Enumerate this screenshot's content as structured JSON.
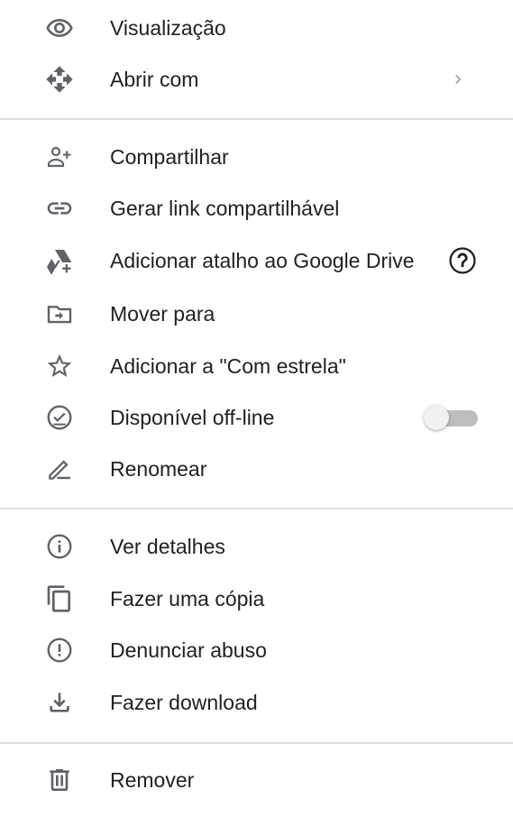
{
  "menu": {
    "items": [
      {
        "label": "Visualização",
        "icon": "eye-icon"
      },
      {
        "label": "Abrir com",
        "icon": "open-with-arrows-icon",
        "submenu": true
      },
      {
        "label": "Compartilhar",
        "icon": "person-add-icon"
      },
      {
        "label": "Gerar link compartilhável",
        "icon": "link-icon"
      },
      {
        "label": "Adicionar atalho ao Google Drive",
        "icon": "drive-shortcut-icon",
        "help": true
      },
      {
        "label": "Mover para",
        "icon": "move-to-folder-icon"
      },
      {
        "label": "Adicionar a \"Com estrela\"",
        "icon": "star-outline-icon"
      },
      {
        "label": "Disponível off-line",
        "icon": "offline-check-icon",
        "toggle": false
      },
      {
        "label": "Renomear",
        "icon": "pencil-icon"
      },
      {
        "label": "Ver detalhes",
        "icon": "info-icon"
      },
      {
        "label": "Fazer uma cópia",
        "icon": "copy-icon"
      },
      {
        "label": "Denunciar abuso",
        "icon": "report-icon"
      },
      {
        "label": "Fazer download",
        "icon": "download-icon"
      },
      {
        "label": "Remover",
        "icon": "trash-icon"
      }
    ]
  },
  "colors": {
    "text": "#202124",
    "icon": "#5f6368",
    "divider": "#e0e0e0",
    "toggle_track": "#bdbdbd",
    "toggle_knob": "#f1f1f1"
  }
}
